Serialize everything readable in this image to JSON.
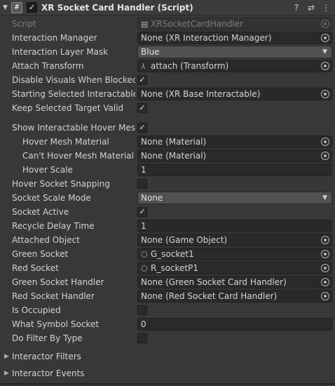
{
  "component": {
    "title": "XR Socket Card Handler (Script)",
    "script_icon": "#",
    "enabled_mark": "✓",
    "tools": {
      "help_icon": "?",
      "presets_icon": "⇄",
      "menu_icon": "⋮"
    }
  },
  "fields": {
    "script": {
      "label": "Script",
      "value": "XRSocketCardHandler"
    },
    "interaction_manager": {
      "label": "Interaction Manager",
      "value": "None (XR Interaction Manager)"
    },
    "interaction_layer_mask": {
      "label": "Interaction Layer Mask",
      "value": "Blue"
    },
    "attach_transform": {
      "label": "Attach Transform",
      "value": "attach (Transform)"
    },
    "disable_visuals": {
      "label": "Disable Visuals When Blocked In",
      "checked": "✓"
    },
    "starting_selected": {
      "label": "Starting Selected Interactable",
      "value": "None (XR Base Interactable)"
    },
    "keep_selected": {
      "label": "Keep Selected Target Valid",
      "checked": "✓"
    },
    "show_hover_mesh": {
      "label": "Show Interactable Hover Meshes",
      "checked": "✓"
    },
    "hover_mesh_material": {
      "label": "Hover Mesh Material",
      "value": "None (Material)"
    },
    "cant_hover_mesh_material": {
      "label": "Can't Hover Mesh Material",
      "value": "None (Material)"
    },
    "hover_scale": {
      "label": "Hover Scale",
      "value": "1"
    },
    "hover_socket_snapping": {
      "label": "Hover Socket Snapping",
      "checked": ""
    },
    "socket_scale_mode": {
      "label": "Socket Scale Mode",
      "value": "None"
    },
    "socket_active": {
      "label": "Socket Active",
      "checked": "✓"
    },
    "recycle_delay_time": {
      "label": "Recycle Delay Time",
      "value": "1"
    },
    "attached_object": {
      "label": "Attached Object",
      "value": "None (Game Object)"
    },
    "green_socket": {
      "label": "Green Socket",
      "value": "G_socket1"
    },
    "red_socket": {
      "label": "Red Socket",
      "value": "R_socketP1"
    },
    "green_socket_handler": {
      "label": "Green Socket Handler",
      "value": "None (Green Socket Card Handler)"
    },
    "red_socket_handler": {
      "label": "Red Socket Handler",
      "value": "None (Red Socket Card Handler)"
    },
    "is_occupied": {
      "label": "Is Occupied",
      "checked": ""
    },
    "what_symbol_socket": {
      "label": "What Symbol Socket",
      "value": "0"
    },
    "do_filter_by_type": {
      "label": "Do Filter By Type",
      "checked": ""
    }
  },
  "foldouts": {
    "interactor_filters": "Interactor Filters",
    "interactor_events": "Interactor Events"
  },
  "icons": {
    "fold_open": "▼",
    "fold_closed": "▶",
    "dropdown_caret": "▼",
    "transform_icon": "⅄",
    "gameobject_icon": "⬡",
    "script_file_icon": "▤"
  },
  "colors": {
    "background": "#383838",
    "field": "#2a2a2a",
    "text": "#d2d2d2",
    "disabled_text": "#7d7d7d"
  }
}
